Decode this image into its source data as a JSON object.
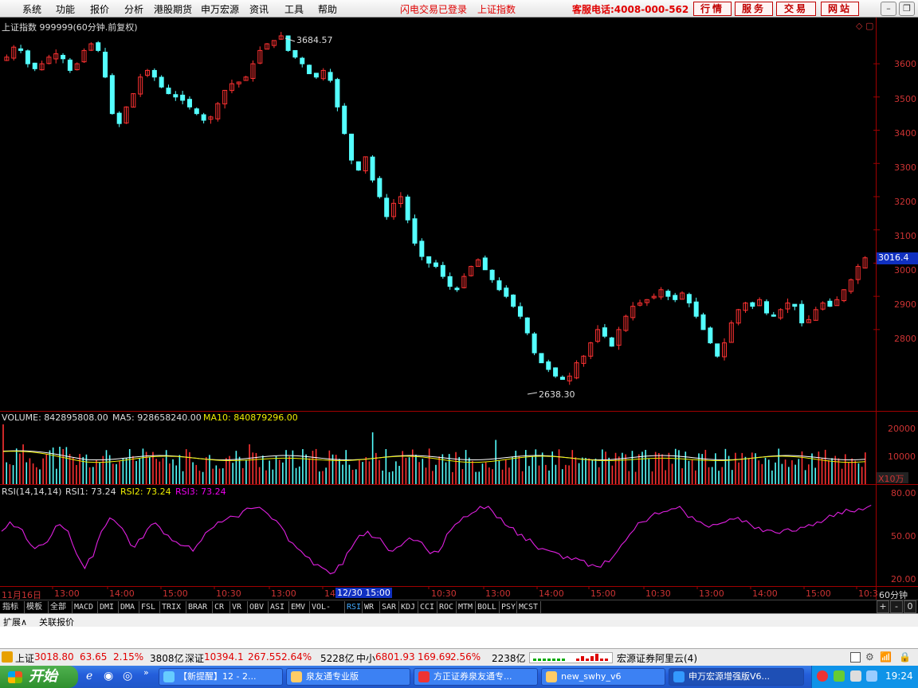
{
  "menu": {
    "items": [
      "系统",
      "功能",
      "报价",
      "分析",
      "港股期货",
      "申万宏源",
      "资讯",
      "工具",
      "帮助"
    ],
    "notice1": "闪电交易已登录",
    "notice2": "上证指数",
    "hotline": "客服电话:4008-000-562",
    "buttons": [
      "行情",
      "服务",
      "交易",
      "网站"
    ]
  },
  "price_panel": {
    "title": "上证指数 999999(60分钟.前复权)",
    "high_label": "3684.57",
    "low_label": "2638.30",
    "current_label": "3016.4",
    "y_ticks": [
      "3600",
      "3500",
      "3400",
      "3300",
      "3200",
      "3100",
      "3000",
      "2900",
      "2800"
    ]
  },
  "volume_panel": {
    "title": "VOLUME: 842895808.00",
    "ma5": "MA5: 928658240.00",
    "ma10": "MA10: 840879296.00",
    "y_ticks": [
      "20000",
      "10000"
    ],
    "unit": "X10万"
  },
  "rsi_panel": {
    "title": "RSI(14,14,14)",
    "rsi1": "RSI1: 73.24",
    "rsi2": "RSI2: 73.24",
    "rsi3": "RSI3: 73.24",
    "y_ticks": [
      "80.00",
      "50.00",
      "20.00"
    ]
  },
  "time_axis": {
    "labels": [
      "11月16日",
      "13:00",
      "14:00",
      "15:00",
      "10:30",
      "13:00",
      "14",
      "12/30 15:00",
      "10:30",
      "13:00",
      "14:00",
      "15:00",
      "10:30",
      "13:00",
      "14:00",
      "15:00",
      "10:3"
    ],
    "period": "60分钟"
  },
  "tabs": [
    "指标",
    "模板",
    "全部",
    "MACD",
    "DMI",
    "DMA",
    "FSL",
    "TRIX",
    "BRAR",
    "CR",
    "VR",
    "OBV",
    "ASI",
    "EMV",
    "VOL-TDX",
    "RSI",
    "WR",
    "SAR",
    "KDJ",
    "CCI",
    "ROC",
    "MTM",
    "BOLL",
    "PSY",
    "MCST"
  ],
  "tab_controls": [
    "+",
    "-",
    "0"
  ],
  "expand_bar": {
    "expand": "扩展∧",
    "related": "关联报价"
  },
  "status": {
    "sh_name": "上证",
    "sh_val": "3018.80",
    "sh_chg": "63.65",
    "sh_pct": "2.15%",
    "sh_amt": "3808亿",
    "sz_name": "深证",
    "sz_val": "10394.1",
    "sz_chg": "267.55",
    "sz_pct": "2.64%",
    "sz_amt": "5228亿",
    "zx_name": "中小",
    "zx_val": "6801.93",
    "zx_chg": "169.69",
    "zx_pct": "2.56%",
    "zx_amt": "2238亿",
    "server": "宏源证券阿里云(4)"
  },
  "taskbar": {
    "start": "开始",
    "tasks": [
      "【新提醒】12 - 2...",
      "泉友通专业版",
      "方正证券泉友通专...",
      "new_swhy_v6",
      "申万宏源增强版V6..."
    ],
    "clock": "19:24"
  },
  "chart_data": {
    "type": "candlestick",
    "title": "上证指数 999999(60分钟.前复权)",
    "close_series": [
      3620,
      3650,
      3640,
      3600,
      3585,
      3600,
      3620,
      3630,
      3615,
      3580,
      3600,
      3640,
      3660,
      3640,
      3560,
      3450,
      3420,
      3470,
      3510,
      3560,
      3580,
      3560,
      3530,
      3510,
      3500,
      3490,
      3470,
      3450,
      3430,
      3440,
      3480,
      3520,
      3540,
      3545,
      3560,
      3600,
      3640,
      3660,
      3670,
      3684,
      3640,
      3620,
      3600,
      3570,
      3560,
      3580,
      3550,
      3470,
      3390,
      3310,
      3280,
      3320,
      3250,
      3200,
      3140,
      3180,
      3200,
      3130,
      3060,
      3020,
      3000,
      2990,
      2960,
      2930,
      2920,
      2960,
      2990,
      3010,
      2980,
      2950,
      2920,
      2900,
      2870,
      2840,
      2790,
      2730,
      2700,
      2680,
      2660,
      2650,
      2660,
      2700,
      2720,
      2760,
      2800,
      2780,
      2750,
      2800,
      2840,
      2870,
      2880,
      2890,
      2900,
      2920,
      2900,
      2890,
      2910,
      2880,
      2840,
      2800,
      2760,
      2720,
      2760,
      2820,
      2860,
      2880,
      2870,
      2890,
      2850,
      2840,
      2860,
      2880,
      2870,
      2820,
      2830,
      2860,
      2880,
      2870,
      2890,
      2920,
      2950,
      2990,
      3016
    ],
    "volume_ma_level": 8500,
    "rsi_series": [
      55,
      62,
      58,
      49,
      42,
      45,
      52,
      60,
      55,
      38,
      27,
      36,
      55,
      65,
      60,
      52,
      43,
      50,
      60,
      58,
      52,
      47,
      44,
      40,
      48,
      56,
      62,
      64,
      66,
      70,
      72,
      73,
      68,
      63,
      55,
      46,
      40,
      35,
      30,
      26,
      24,
      30,
      42,
      52,
      55,
      50,
      45,
      40,
      44,
      50,
      48,
      42,
      40,
      44,
      56,
      62,
      66,
      70,
      72,
      70,
      65,
      58,
      52,
      48,
      45,
      42,
      40,
      38,
      36,
      35,
      33,
      30,
      28,
      32,
      40,
      48,
      56,
      62,
      66,
      68,
      70,
      72,
      70,
      66,
      62,
      58,
      60,
      62,
      64,
      62,
      60,
      58,
      56,
      54,
      56,
      55,
      58,
      60,
      62,
      64,
      66,
      68,
      70,
      72,
      73
    ],
    "y_range_price": [
      2560,
      3720
    ],
    "rsi_range": [
      15,
      85
    ]
  }
}
